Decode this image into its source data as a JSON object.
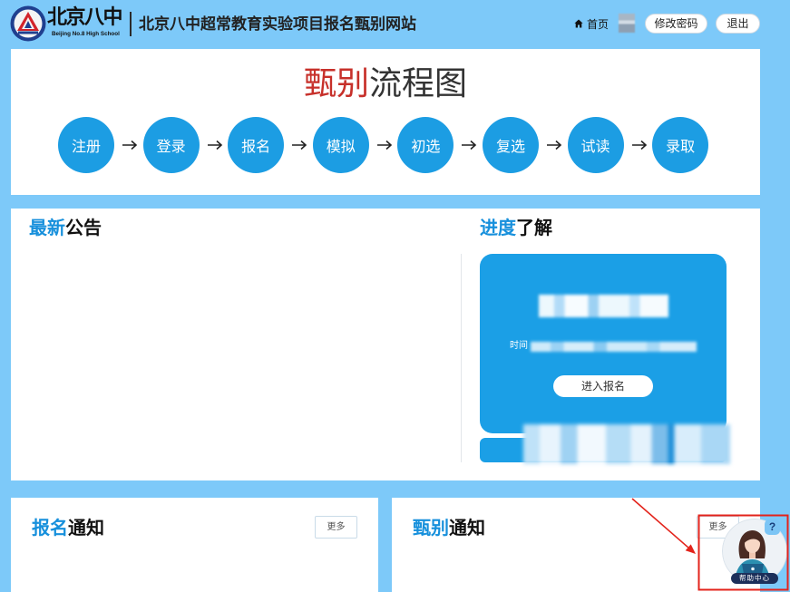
{
  "header": {
    "logo": {
      "emblem_icon": "school-emblem-icon",
      "name_cn": "北京八中",
      "name_en": "Beijing No.8 High School"
    },
    "site_title": "北京八中超常教育实验项目报名甄别网站",
    "nav": {
      "home_icon": "home-icon",
      "home_label": "首页",
      "change_password_label": "修改密码",
      "logout_label": "退出"
    }
  },
  "flow": {
    "title_highlight": "甄别",
    "title_rest": "流程图",
    "connector_icon": "arrow-right-icon",
    "steps": [
      "注册",
      "登录",
      "报名",
      "模拟",
      "初选",
      "复选",
      "试读",
      "录取"
    ]
  },
  "announcements": {
    "title_highlight": "最新",
    "title_rest": "公告"
  },
  "progress": {
    "title_highlight": "进度",
    "title_rest": "了解",
    "time_label": "时间",
    "enter_button_label": "进入报名"
  },
  "registration_notices": {
    "title_highlight": "报名",
    "title_rest": "通知",
    "more_label": "更多"
  },
  "screening_notices": {
    "title_highlight": "甄别",
    "title_rest": "通知",
    "more_label": "更多"
  },
  "help_center": {
    "badge": "?",
    "label": "帮助中心"
  },
  "colors": {
    "page_background": "#7dc9f9",
    "primary_blue": "#1c9de3",
    "title_blue": "#1790dc",
    "title_red": "#c7302a",
    "annotation_red": "#e3231b"
  }
}
